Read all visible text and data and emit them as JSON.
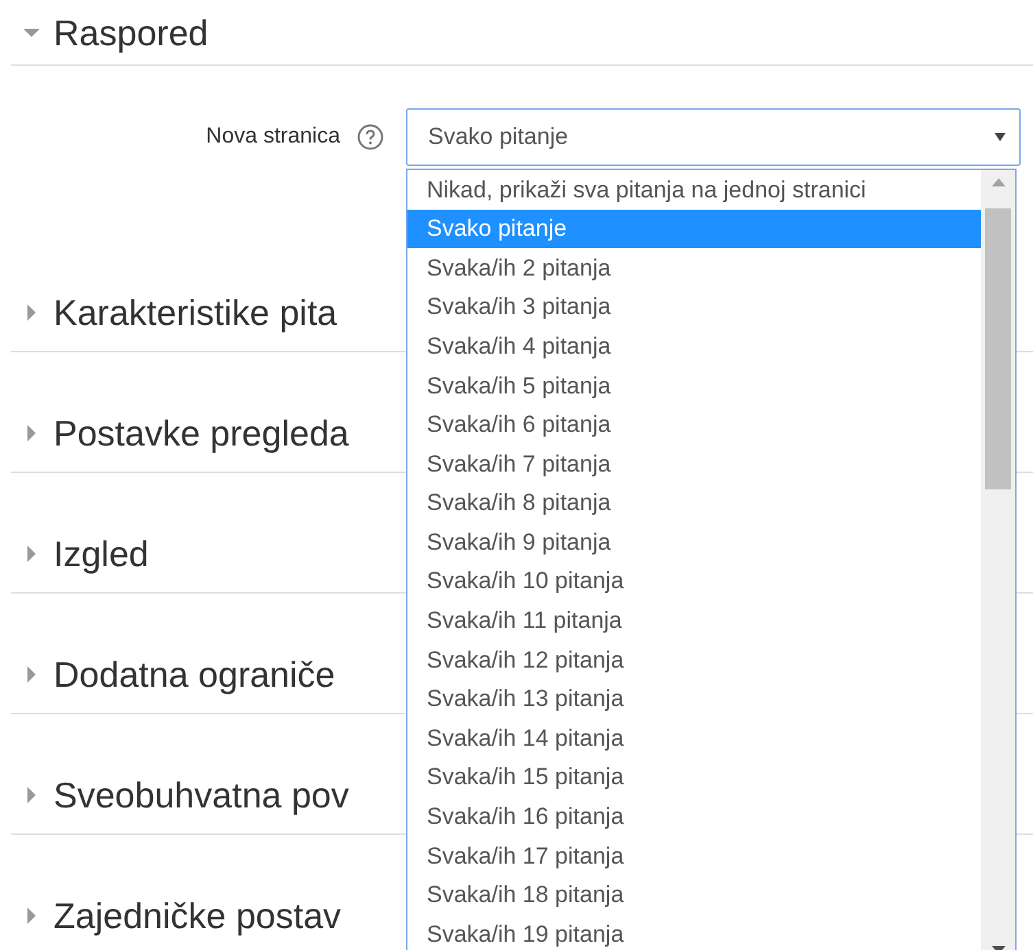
{
  "sections": [
    {
      "title": "Raspored",
      "expanded": true
    },
    {
      "title": "Karakteristike pita",
      "expanded": false
    },
    {
      "title": "Postavke pregleda",
      "expanded": false
    },
    {
      "title": "Izgled",
      "expanded": false
    },
    {
      "title": "Dodatna ograniče",
      "expanded": false
    },
    {
      "title": "Sveobuhvatna pov",
      "expanded": false
    },
    {
      "title": "Zajedničke postav",
      "expanded": false
    }
  ],
  "field": {
    "label": "Nova stranica",
    "value": "Svako pitanje",
    "expanded": true,
    "options": [
      {
        "label": "Nikad, prikaži sva pitanja na jednoj stranici",
        "selected": false
      },
      {
        "label": "Svako pitanje",
        "selected": true
      },
      {
        "label": "Svaka/ih 2 pitanja",
        "selected": false
      },
      {
        "label": "Svaka/ih 3 pitanja",
        "selected": false
      },
      {
        "label": "Svaka/ih 4 pitanja",
        "selected": false
      },
      {
        "label": "Svaka/ih 5 pitanja",
        "selected": false
      },
      {
        "label": "Svaka/ih 6 pitanja",
        "selected": false
      },
      {
        "label": "Svaka/ih 7 pitanja",
        "selected": false
      },
      {
        "label": "Svaka/ih 8 pitanja",
        "selected": false
      },
      {
        "label": "Svaka/ih 9 pitanja",
        "selected": false
      },
      {
        "label": "Svaka/ih 10 pitanja",
        "selected": false
      },
      {
        "label": "Svaka/ih 11 pitanja",
        "selected": false
      },
      {
        "label": "Svaka/ih 12 pitanja",
        "selected": false
      },
      {
        "label": "Svaka/ih 13 pitanja",
        "selected": false
      },
      {
        "label": "Svaka/ih 14 pitanja",
        "selected": false
      },
      {
        "label": "Svaka/ih 15 pitanja",
        "selected": false
      },
      {
        "label": "Svaka/ih 16 pitanja",
        "selected": false
      },
      {
        "label": "Svaka/ih 17 pitanja",
        "selected": false
      },
      {
        "label": "Svaka/ih 18 pitanja",
        "selected": false
      },
      {
        "label": "Svaka/ih 19 pitanja",
        "selected": false
      }
    ]
  }
}
